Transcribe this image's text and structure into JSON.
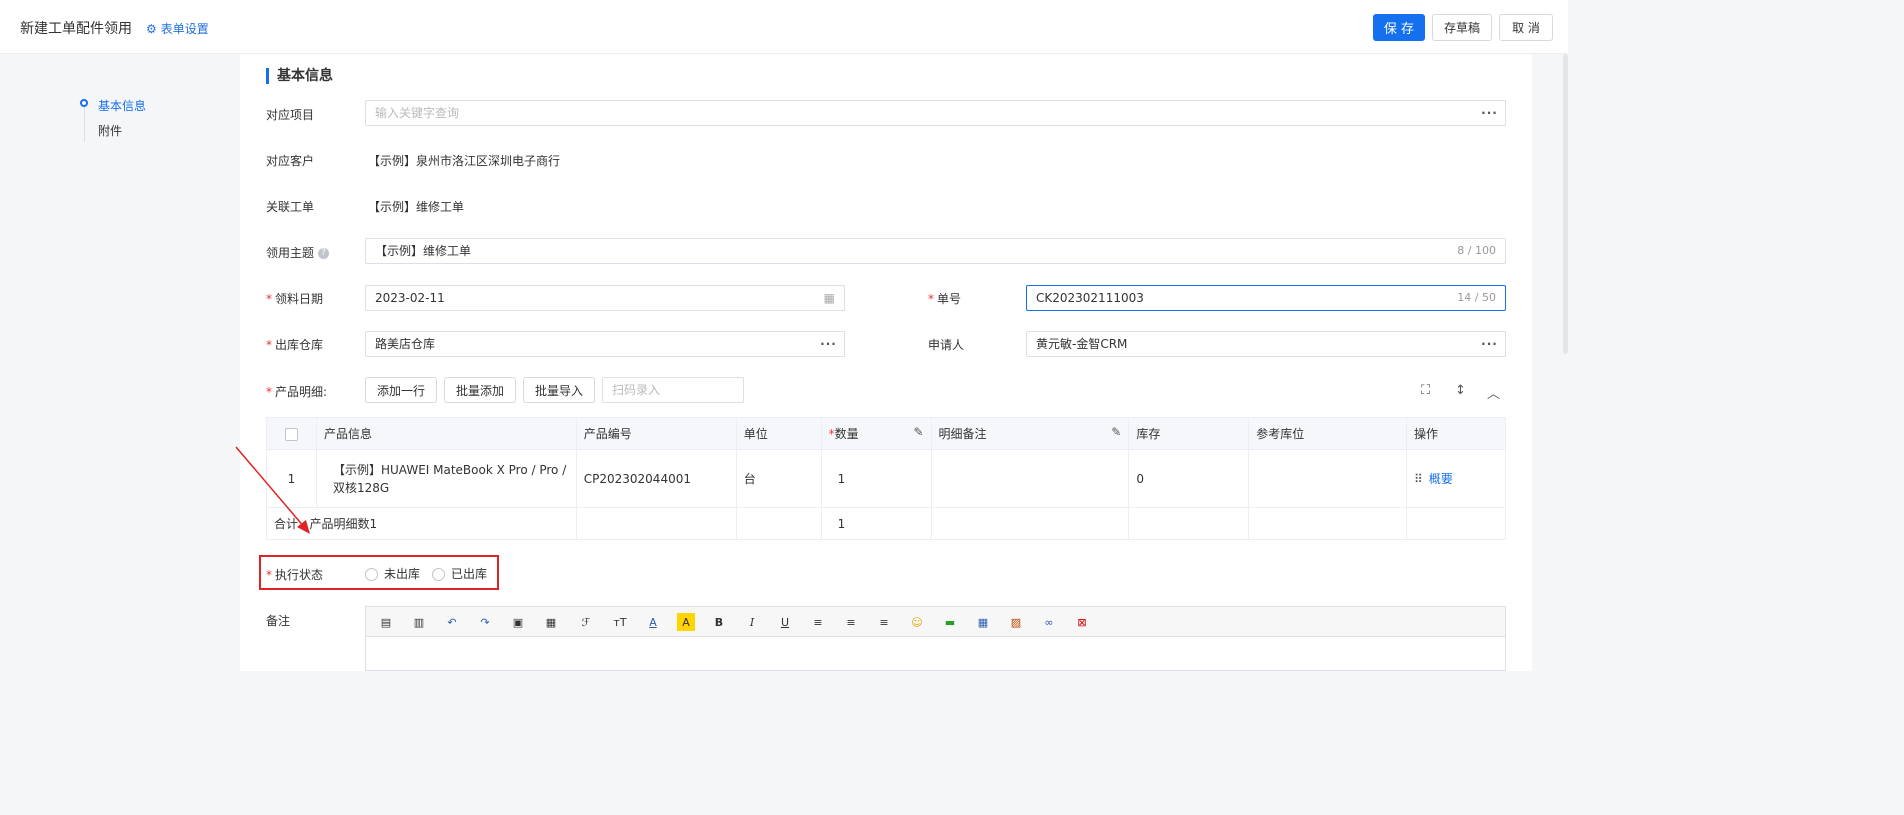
{
  "header": {
    "title": "新建工单配件领用",
    "form_setting": "表单设置",
    "save": "保 存",
    "draft": "存草稿",
    "cancel": "取 消"
  },
  "nav": {
    "items": [
      {
        "label": "基本信息"
      },
      {
        "label": "附件"
      }
    ]
  },
  "section": {
    "title": "基本信息"
  },
  "fields": {
    "project": {
      "label": "对应项目",
      "placeholder": "输入关键字查询"
    },
    "customer": {
      "label": "对应客户",
      "value": "【示例】泉州市洛江区深圳电子商行"
    },
    "workorder": {
      "label": "关联工单",
      "value": "【示例】维修工单"
    },
    "subject": {
      "label": "领用主题",
      "value": "【示例】维修工单",
      "count": "8 / 100"
    },
    "date": {
      "label": "领料日期",
      "value": "2023-02-11"
    },
    "number": {
      "label": "单号",
      "value": "CK202302111003",
      "count": "14 / 50"
    },
    "warehouse": {
      "label": "出库仓库",
      "value": "路美店仓库"
    },
    "applicant": {
      "label": "申请人",
      "value": "黄元敏-金智CRM"
    },
    "products": {
      "label": "产品明细:"
    }
  },
  "product_actions": {
    "add_row": "添加一行",
    "batch_add": "批量添加",
    "batch_import": "批量导入",
    "scan_placeholder": "扫码录入"
  },
  "table": {
    "headers": [
      "产品信息",
      "产品编号",
      "单位",
      "数量",
      "明细备注",
      "库存",
      "参考库位",
      "操作"
    ],
    "rows": [
      {
        "index": "1",
        "info": "【示例】HUAWEI MateBook X Pro / Pro / 双核128G",
        "code": "CP202302044001",
        "unit": "台",
        "qty": "1",
        "remark": "",
        "stock": "0",
        "location": "",
        "action": "概要"
      }
    ],
    "summary": {
      "label": "合计",
      "count_label": "产品明细数1",
      "qty": "1"
    }
  },
  "status": {
    "label": "执行状态",
    "options": [
      "未出库",
      "已出库"
    ]
  },
  "remark": {
    "label": "备注"
  },
  "colors": {
    "primary": "#1570ef",
    "annotation": "#e02424"
  }
}
